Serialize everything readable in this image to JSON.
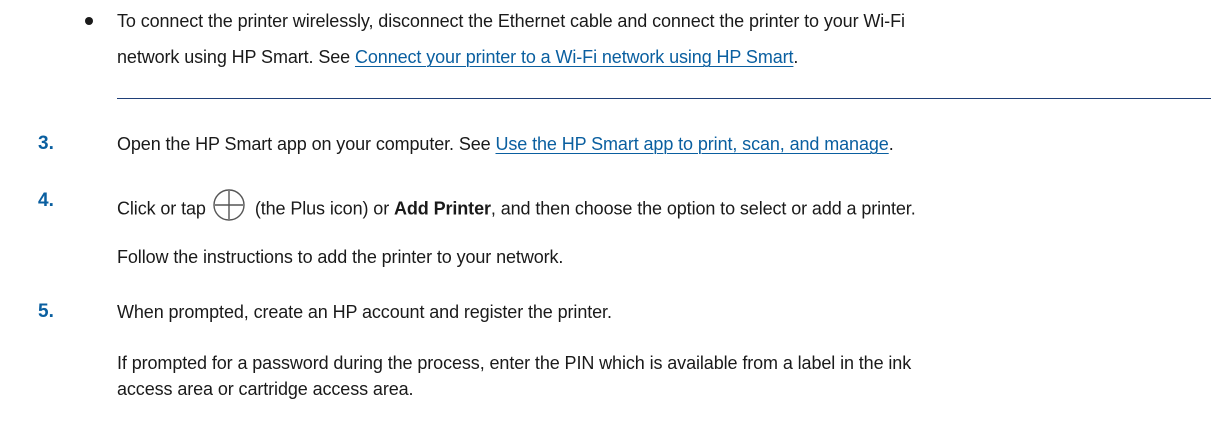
{
  "bullet": {
    "line1": "To connect the printer wirelessly, disconnect the Ethernet cable and connect the printer to your Wi-Fi",
    "line2_prefix": "network using HP Smart. See ",
    "line2_link": "Connect your printer to a Wi-Fi network using HP Smart",
    "line2_suffix": "."
  },
  "step3": {
    "number": "3.",
    "prefix": "Open the HP Smart app on your computer. See ",
    "link": "Use the HP Smart app to print, scan, and manage",
    "suffix": "."
  },
  "step4": {
    "number": "4.",
    "prefix": "Click or tap",
    "icon": "plus-circle-icon",
    "middle": "(the Plus icon) or ",
    "bold": "Add Printer",
    "suffix": ", and then choose the option to select or add a printer.",
    "follow": "Follow the instructions to add the printer to your network."
  },
  "step5": {
    "number": "5.",
    "text": "When prompted, create an HP account and register the printer.",
    "note_line1": "If prompted for a password during the process, enter the PIN which is available from a label in the ink",
    "note_line2": "access area or cartridge access area."
  },
  "colors": {
    "link": "#0a5fa0",
    "step_number": "#0a5fa0",
    "divider": "#1f3f78",
    "text": "#1a1a1a"
  }
}
